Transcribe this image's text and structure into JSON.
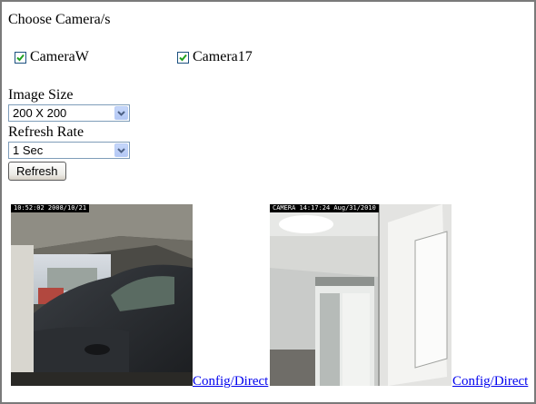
{
  "page": {
    "heading": "Choose Camera/s"
  },
  "cameras": [
    {
      "label": "CameraW",
      "checked": true
    },
    {
      "label": "Camera17",
      "checked": true
    }
  ],
  "image_size": {
    "label": "Image Size",
    "selected": "200 X 200"
  },
  "refresh_rate": {
    "label": "Refresh Rate",
    "selected": "1 Sec"
  },
  "refresh_button": {
    "label": "Refresh"
  },
  "feeds": [
    {
      "camera": "CameraW",
      "timestamp": "10:52:02 2008/10/21",
      "link": "Config/Direct"
    },
    {
      "camera": "Camera17",
      "timestamp": "CAMERA 14:17:24 Aug/31/2010",
      "link": "Config/Direct"
    }
  ],
  "colors": {
    "checkbox_check": "#21a121",
    "link": "#0000ee",
    "select_arrow": "#4d6185"
  }
}
